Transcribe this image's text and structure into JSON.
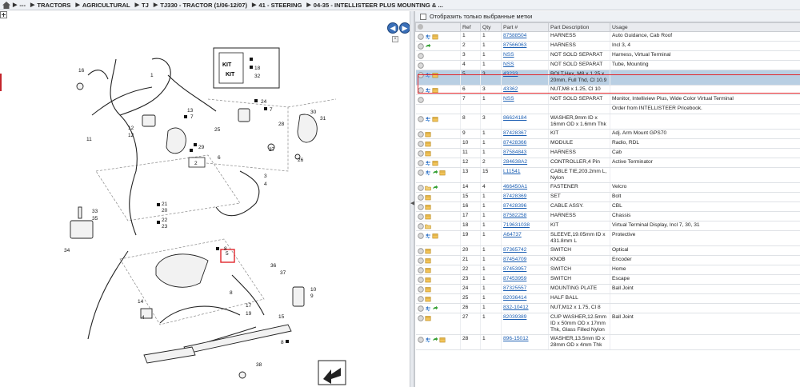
{
  "breadcrumb": {
    "items": [
      "---",
      "TRACTORS",
      "AGRICULTURAL",
      "TJ",
      "TJ330 - TRACTOR (1/06-12/07)",
      "41 - STEERING",
      "04-35 - INTELLISTEER PLUS MOUNTING & ..."
    ]
  },
  "filter": {
    "label": "Отобразить только выбранные метки"
  },
  "diagram": {
    "kit_labels": [
      "18",
      "32"
    ],
    "callouts": [
      "1",
      "16",
      "2",
      "3",
      "4",
      "5",
      "6",
      "7",
      "8",
      "9",
      "10",
      "11",
      "12",
      "13",
      "14",
      "15",
      "17",
      "19",
      "20",
      "21",
      "22",
      "23",
      "24",
      "25",
      "26",
      "27",
      "28",
      "29",
      "30",
      "31",
      "33",
      "34",
      "35",
      "36",
      "37",
      "38"
    ]
  },
  "table": {
    "headers": [
      "Ref",
      "Qty",
      "Part #",
      "Part Description",
      "Usage"
    ],
    "rows": [
      {
        "icons": [
          "circle",
          "swap",
          "box"
        ],
        "ref": "1",
        "qty": "1",
        "part": "87588504",
        "desc": "HARNESS",
        "usage": "Auto Guidance, Cab Roof"
      },
      {
        "icons": [
          "circle",
          "arrow"
        ],
        "ref": "2",
        "qty": "1",
        "part": "87566063",
        "desc": "HARNESS",
        "usage": "Incl 3, 4"
      },
      {
        "icons": [
          "circle"
        ],
        "ref": "3",
        "qty": "1",
        "part": "NSS",
        "desc": "NOT SOLD SEPARAT",
        "usage": "Harness, Virtual Terminal"
      },
      {
        "icons": [
          "circle"
        ],
        "ref": "4",
        "qty": "1",
        "part": "NSS",
        "desc": "NOT SOLD SEPARAT",
        "usage": "Tube, Mounting"
      },
      {
        "icons": [
          "circle",
          "swap",
          "box"
        ],
        "ref": "5",
        "qty": "3",
        "part": "43233",
        "desc": "BOLT,Hex, M8 x 1.25 x 20mm, Full Thd, Cl 10.9",
        "usage": "",
        "selected": true
      },
      {
        "icons": [
          "circle",
          "swap",
          "box"
        ],
        "ref": "6",
        "qty": "3",
        "part": "43362",
        "desc": "NUT,M8 x 1.25, Cl 10",
        "usage": ""
      },
      {
        "icons": [
          "circle"
        ],
        "ref": "7",
        "qty": "1",
        "part": "NSS",
        "desc": "NOT SOLD SEPARAT",
        "usage": "Monitor, Intelliview Plus, Wide Color Virtual Terminal"
      },
      {
        "icons": [],
        "ref": "",
        "qty": "",
        "part": "",
        "desc": "",
        "usage": "Order from INTELLISTEER Pricebook."
      },
      {
        "icons": [
          "circle",
          "swap",
          "box"
        ],
        "ref": "8",
        "qty": "3",
        "part": "86624184",
        "desc": "WASHER,9mm ID x 16mm OD x 1.6mm Thk",
        "usage": ""
      },
      {
        "icons": [
          "circle",
          "box"
        ],
        "ref": "9",
        "qty": "1",
        "part": "87428367",
        "desc": "KIT",
        "usage": "Adj. Arm Mount GPS70"
      },
      {
        "icons": [
          "circle",
          "box"
        ],
        "ref": "10",
        "qty": "1",
        "part": "87428366",
        "desc": "MODULE",
        "usage": "Radio, RDL"
      },
      {
        "icons": [
          "circle",
          "box"
        ],
        "ref": "11",
        "qty": "1",
        "part": "87584843",
        "desc": "HARNESS",
        "usage": "Cab"
      },
      {
        "icons": [
          "circle",
          "swap",
          "box"
        ],
        "ref": "12",
        "qty": "2",
        "part": "284638A2",
        "desc": "CONTROLLER,4 Pin",
        "usage": "Active Terminator"
      },
      {
        "icons": [
          "circle",
          "swap",
          "arrow",
          "box"
        ],
        "ref": "13",
        "qty": "15",
        "part": "L11541",
        "desc": "CABLE TIE,203.2mm L, Nylon",
        "usage": ""
      },
      {
        "icons": [
          "circle",
          "folder",
          "arrow"
        ],
        "ref": "14",
        "qty": "4",
        "part": "466450A1",
        "desc": "FASTENER",
        "usage": "Velcro"
      },
      {
        "icons": [
          "circle",
          "box"
        ],
        "ref": "15",
        "qty": "1",
        "part": "87428369",
        "desc": "SET",
        "usage": "Bolt"
      },
      {
        "icons": [
          "circle",
          "box"
        ],
        "ref": "16",
        "qty": "1",
        "part": "87428396",
        "desc": "CABLE ASSY.",
        "usage": "CBL"
      },
      {
        "icons": [
          "circle",
          "box"
        ],
        "ref": "17",
        "qty": "1",
        "part": "87582258",
        "desc": "HARNESS",
        "usage": "Chassis"
      },
      {
        "icons": [
          "circle",
          "folder"
        ],
        "ref": "18",
        "qty": "1",
        "part": "719631038",
        "desc": "KIT",
        "usage": "Virtual Terminal Display, Incl 7, 30, 31"
      },
      {
        "icons": [
          "circle",
          "swap",
          "box"
        ],
        "ref": "19",
        "qty": "1",
        "part": "A64737",
        "desc": "SLEEVE,19.05mm ID x 431.8mm L",
        "usage": "Protective"
      },
      {
        "icons": [
          "circle",
          "box"
        ],
        "ref": "20",
        "qty": "1",
        "part": "87365742",
        "desc": "SWITCH",
        "usage": "Optical"
      },
      {
        "icons": [
          "circle",
          "box"
        ],
        "ref": "21",
        "qty": "1",
        "part": "87454709",
        "desc": "KNOB",
        "usage": "Encoder"
      },
      {
        "icons": [
          "circle",
          "box"
        ],
        "ref": "22",
        "qty": "1",
        "part": "87453957",
        "desc": "SWITCH",
        "usage": "Home"
      },
      {
        "icons": [
          "circle",
          "box"
        ],
        "ref": "23",
        "qty": "1",
        "part": "87453959",
        "desc": "SWITCH",
        "usage": "Escape"
      },
      {
        "icons": [
          "circle",
          "box"
        ],
        "ref": "24",
        "qty": "1",
        "part": "87325557",
        "desc": "MOUNTING PLATE",
        "usage": "Ball Joint"
      },
      {
        "icons": [
          "circle",
          "box"
        ],
        "ref": "25",
        "qty": "1",
        "part": "82036414",
        "desc": "HALF BALL",
        "usage": ""
      },
      {
        "icons": [
          "circle",
          "swap",
          "arrow"
        ],
        "ref": "26",
        "qty": "1",
        "part": "832-10412",
        "desc": "NUT,M12 x 1.75, Cl 8",
        "usage": ""
      },
      {
        "icons": [
          "circle",
          "box"
        ],
        "ref": "27",
        "qty": "1",
        "part": "82039389",
        "desc": "CUP WASHER,12.5mm ID x 50mm OD x 17mm Thk, Glass Filled Nylon",
        "usage": "Ball Joint"
      },
      {
        "icons": [
          "circle",
          "swap",
          "arrow",
          "box"
        ],
        "ref": "28",
        "qty": "1",
        "part": "896-15012",
        "desc": "WASHER,13.5mm ID x 28mm OD x 4mm Thk",
        "usage": ""
      }
    ]
  },
  "colors": {
    "link": "#1c5fb3",
    "selected_row": "#b9cfe3",
    "highlight": "#e1262c",
    "nav_button": "#3a6fb8"
  }
}
